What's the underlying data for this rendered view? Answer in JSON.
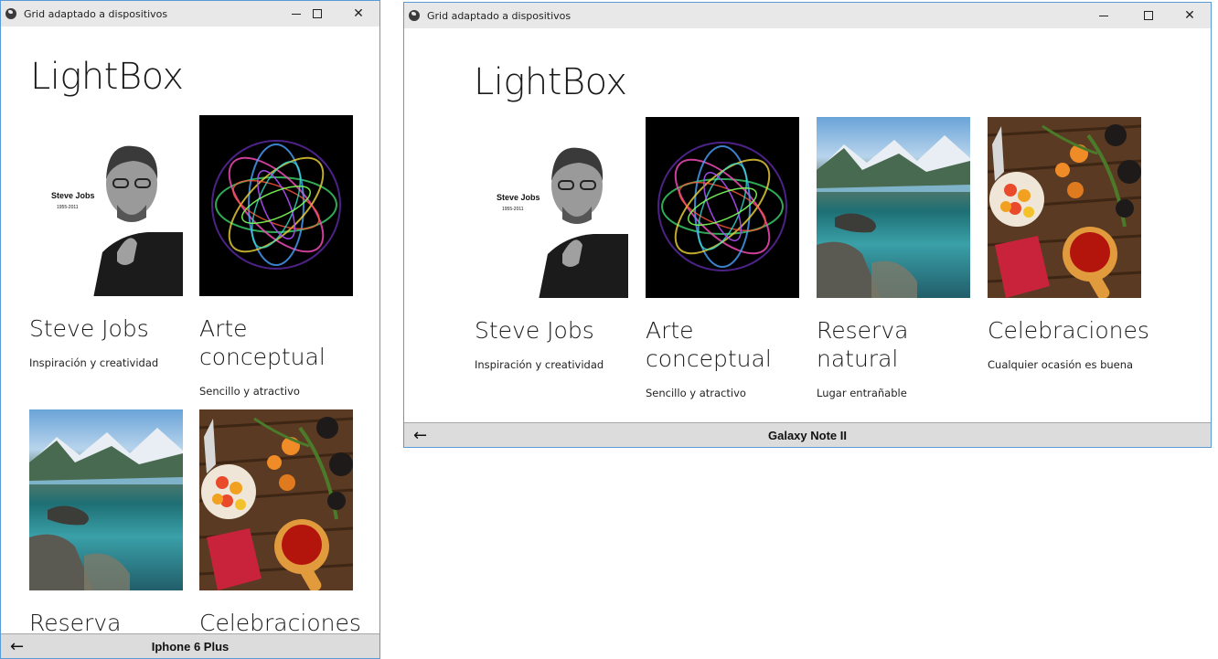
{
  "window_title": "Grid adaptado a dispositivos",
  "app_heading": "LightBox",
  "controls": {
    "minimize": "",
    "maximize": "",
    "close": "✕"
  },
  "statusbar": {
    "back_glyph": "←"
  },
  "devices": {
    "phone": "Iphone 6 Plus",
    "tablet": "Galaxy Note II"
  },
  "items": [
    {
      "title": "Steve Jobs",
      "subtitle": "Inspiración y creatividad",
      "image_text": "Steve Jobs",
      "image_subtext": "1955-2011"
    },
    {
      "title": "Arte conceptual",
      "subtitle": "Sencillo y atractivo"
    },
    {
      "title": "Reserva natural",
      "subtitle": "Lugar entrañable"
    },
    {
      "title": "Celebraciones",
      "subtitle": "Cualquier ocasión es buena"
    }
  ],
  "phone_partial_titles": {
    "item3": "Reserva",
    "item4": "Celebraciones"
  },
  "colors": {
    "window_border": "#5b9bd5",
    "titlebar_bg": "#e8e8e8",
    "statusbar_bg": "#dcdcdc"
  }
}
